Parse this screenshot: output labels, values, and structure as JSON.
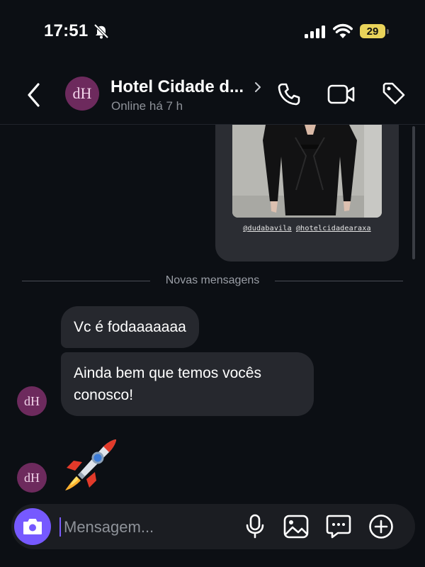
{
  "status_bar": {
    "time": "17:51",
    "battery": "29",
    "icons": [
      "bell-slash-icon",
      "signal-icon",
      "wifi-icon",
      "battery-icon"
    ]
  },
  "header": {
    "avatar_initials": "dH",
    "contact_name": "Hotel Cidade d...",
    "status": "Online há 7 h",
    "actions": [
      "back-arrow-icon",
      "chevron-right-icon",
      "phone-icon",
      "video-icon",
      "tag-icon"
    ]
  },
  "shared_story": {
    "mentions": [
      "@dudabavila",
      "@hotelcidadearaxa"
    ]
  },
  "divider": {
    "label": "Novas mensagens"
  },
  "messages": [
    {
      "text": "Vc é fodaaaaaaa"
    },
    {
      "text": "Ainda bem que temos vocês conosco!"
    },
    {
      "emoji": "🚀"
    }
  ],
  "message_avatar_initials": "dH",
  "composer": {
    "placeholder": "Mensagem...",
    "icons": [
      "camera-icon",
      "microphone-icon",
      "image-icon",
      "sticker-message-icon",
      "plus-circle-icon"
    ]
  },
  "colors": {
    "background": "#0c0f14",
    "bubble": "#26282e",
    "avatar": "#6d2a5d",
    "camera_button": "#7659ff",
    "battery": "#e9d35a"
  }
}
